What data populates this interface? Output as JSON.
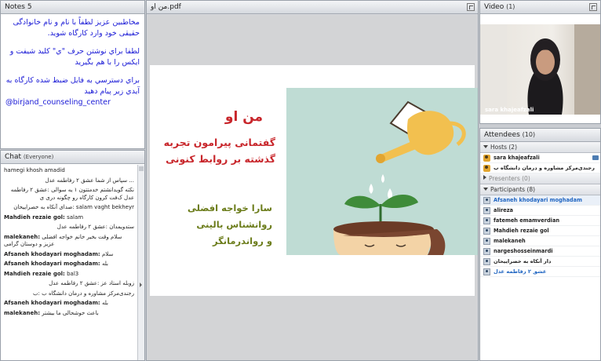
{
  "notes": {
    "title": "Notes",
    "count": "5",
    "lines": [
      "مخاطبین عزیز لطفاً با نام و نام خانوادگی حقیقی خود وارد کارگاه شوید.",
      "لطفا براي نوشتن حرف \"ي\" كليد شيفت و ايكس را با هم بگيريد",
      "براي دسترسي به فايل ضبط شده كارگاه به آيدي زير پيام دهيد"
    ],
    "handle": "@birjand_counseling_center"
  },
  "chat": {
    "title": "Chat",
    "scope": "(Everyone)",
    "messages": [
      {
        "sender": "",
        "text": "hamegi khosh amadid",
        "dir": "ltr"
      },
      {
        "sender": "",
        "text": "... سپاس از شما عشق ۲ رفاطمه عدل",
        "dir": "rtl"
      },
      {
        "sender": "",
        "text": "نکته گویدانشتم خدمتتون ۱ یه سوالی :عشق ۲ رفاطمه عدل ک‌فت کرون کارگاه رو چگونه دری ی",
        "dir": "rtl"
      },
      {
        "sender": "",
        "text": "salam vaght bekheyr :صدای آنکاه به خصراییحان",
        "dir": "rtl"
      },
      {
        "sender": "Mahdieh rezaie gol:",
        "text": "salam",
        "dir": "ltr"
      },
      {
        "sender": "",
        "text": "ستدویمدان :عشق ۲ رفاطمه عدل",
        "dir": "rtl"
      },
      {
        "sender": "malekaneh:",
        "text": "سلام وقت بخیر خانم خواجه افضلی عزیز و دوستان گرامی",
        "dir": "ltr"
      },
      {
        "sender": "Afsaneh khodayari moghadam:",
        "text": "سلام",
        "dir": "ltr"
      },
      {
        "sender": "Afsaneh khodayari moghadam:",
        "text": "بله",
        "dir": "ltr"
      },
      {
        "sender": "Mahdieh rezaie gol:",
        "text": "bal3",
        "dir": "ltr"
      },
      {
        "sender": "",
        "text": "زوبله استاد عز :عشق ۲ رفاطمه عدل",
        "dir": "rtl"
      },
      {
        "sender": "",
        "text": "رجندی‌مرکز مشاوره و درمان دانشگاه ب :ب",
        "dir": "rtl"
      },
      {
        "sender": "Afsaneh khodayari moghadam:",
        "text": "بله",
        "dir": "ltr"
      },
      {
        "sender": "malekaneh:",
        "text": "باعث خوشحالی ما بیشتر",
        "dir": "ltr"
      }
    ]
  },
  "presentation": {
    "filename": "من او.pdf",
    "slide": {
      "title": "من او",
      "subtitle": "گفتمانی پیرامون تجربه گذشته بر روابط کنونی",
      "author_lines": [
        "سارا خواجه افضلی",
        "روانشناس بالینی",
        "و رواندرمانگر"
      ]
    }
  },
  "video": {
    "title": "Video",
    "count": "(1)",
    "speaker": "sara khajeafzali"
  },
  "attendees": {
    "title": "Attendees",
    "count": "(10)",
    "hosts_label": "Hosts (2)",
    "hosts": [
      "sara khajeafzali",
      "رجندی‌مرکز مشاوره و درمان دانشگاه ب"
    ],
    "presenters_label": "Presenters (0)",
    "participants_label": "Participants (8)",
    "participants": [
      "Afsaneh khodayari moghadam",
      "alireza",
      "fatemeh emamverdian",
      "Mahdieh rezaie gol",
      "malekaneh",
      "nargeshosseinmardi",
      "دار آنکاه به خصراییحان",
      "عشق ۲ رفاطمه عدل"
    ]
  },
  "colors": {
    "notes_text": "#1a1ad6",
    "slide_title": "#c8262b",
    "slide_author": "#6b7c1a",
    "slide_art_bg": "#bfdcd4",
    "host_icon": "#e2a52f",
    "selected_name": "#2166c2"
  }
}
